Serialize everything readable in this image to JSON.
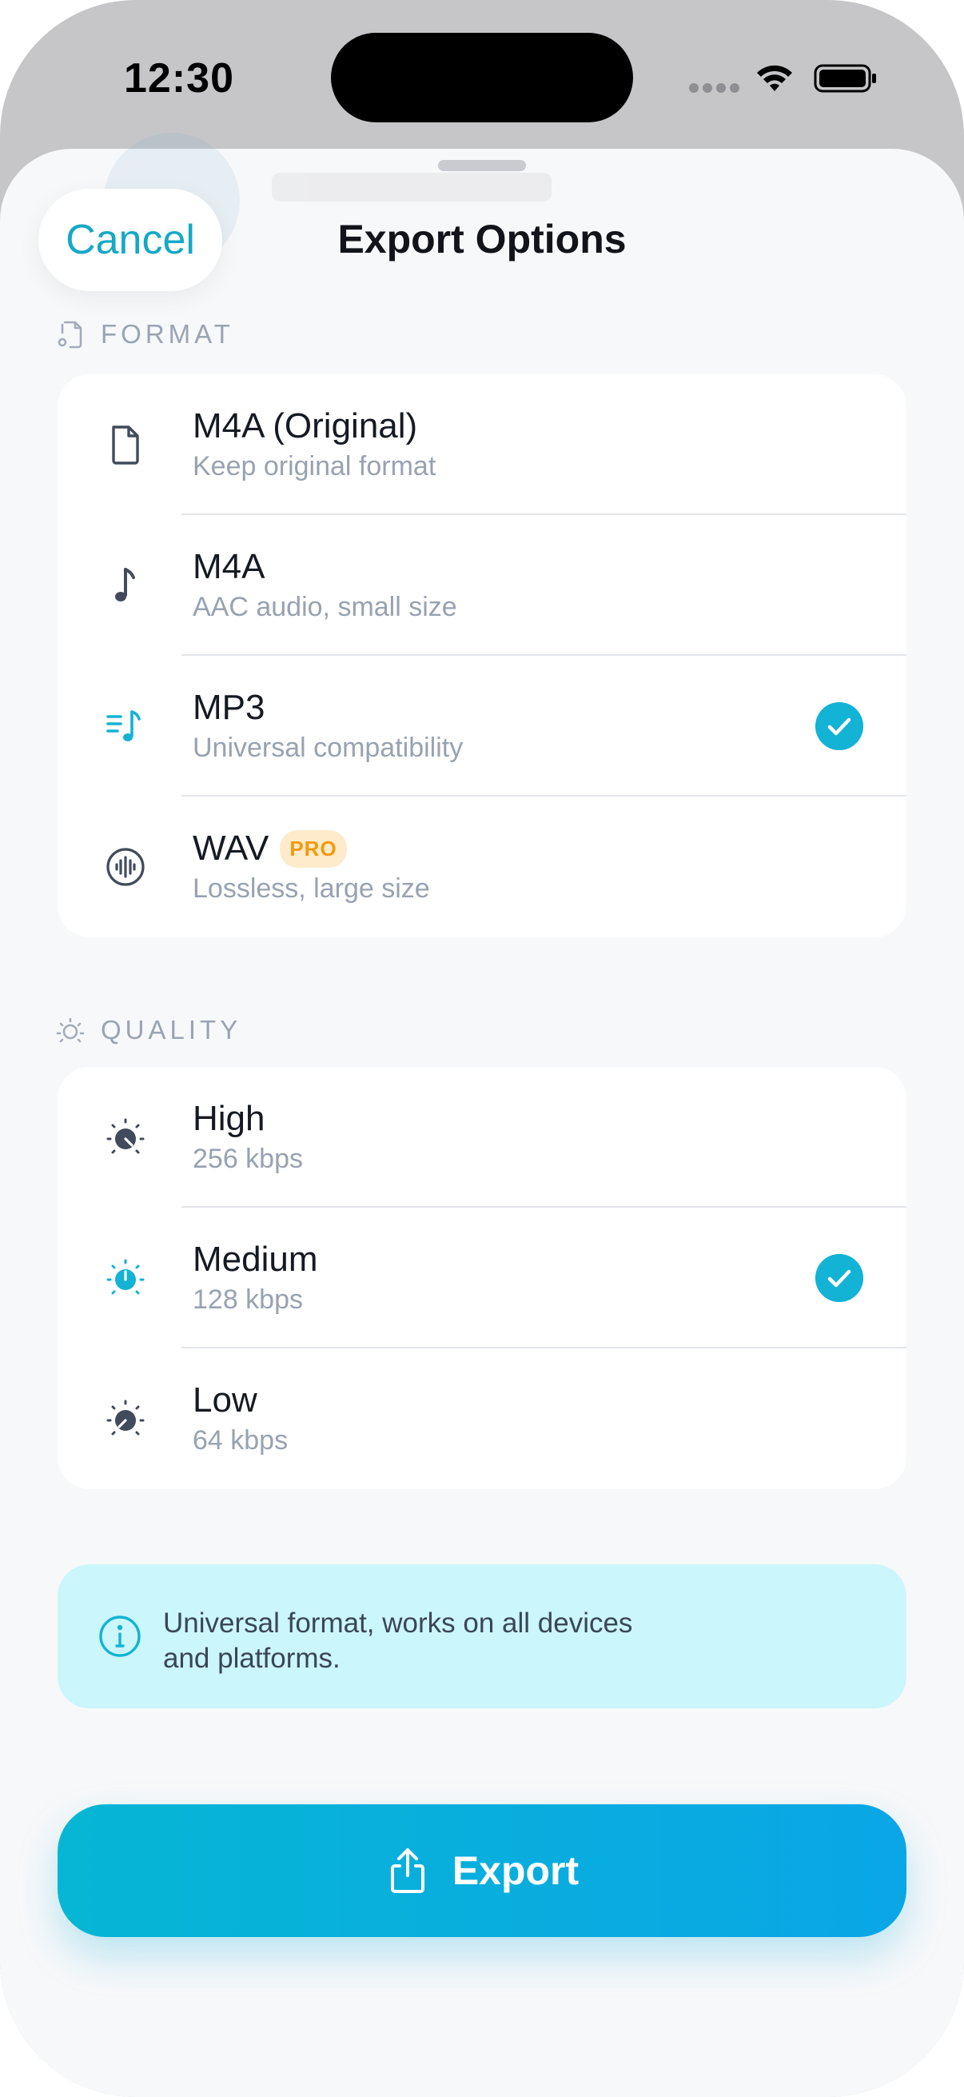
{
  "status_bar": {
    "time": "12:30"
  },
  "header": {
    "title": "Export Options",
    "cancel_label": "Cancel"
  },
  "format": {
    "label": "FORMAT",
    "options": [
      {
        "title": "M4A (Original)",
        "subtitle": "Keep original format",
        "icon": "file-icon",
        "selected": false
      },
      {
        "title": "M4A",
        "subtitle": "AAC audio, small size",
        "icon": "music-note-icon",
        "selected": false
      },
      {
        "title": "MP3",
        "subtitle": "Universal compatibility",
        "icon": "music-list-icon",
        "selected": true
      },
      {
        "title": "WAV",
        "subtitle": "Lossless, large size",
        "icon": "audio-wave-icon",
        "selected": false,
        "badge": "PRO"
      }
    ]
  },
  "quality": {
    "label": "QUALITY",
    "options": [
      {
        "title": "High",
        "subtitle": "256 kbps",
        "icon": "gauge-high-icon",
        "selected": false
      },
      {
        "title": "Medium",
        "subtitle": "128 kbps",
        "icon": "gauge-medium-icon",
        "selected": true
      },
      {
        "title": "Low",
        "subtitle": "64 kbps",
        "icon": "gauge-low-icon",
        "selected": false
      }
    ]
  },
  "info": {
    "text_line1": "Universal format, works on all devices",
    "text_line2": "and platforms."
  },
  "export_button": {
    "label": "Export"
  },
  "colors": {
    "accent": "#12b3d4",
    "pro_badge_bg": "#fdebcc",
    "pro_badge_text": "#f29a0a",
    "info_bg": "#cbf6fb"
  }
}
